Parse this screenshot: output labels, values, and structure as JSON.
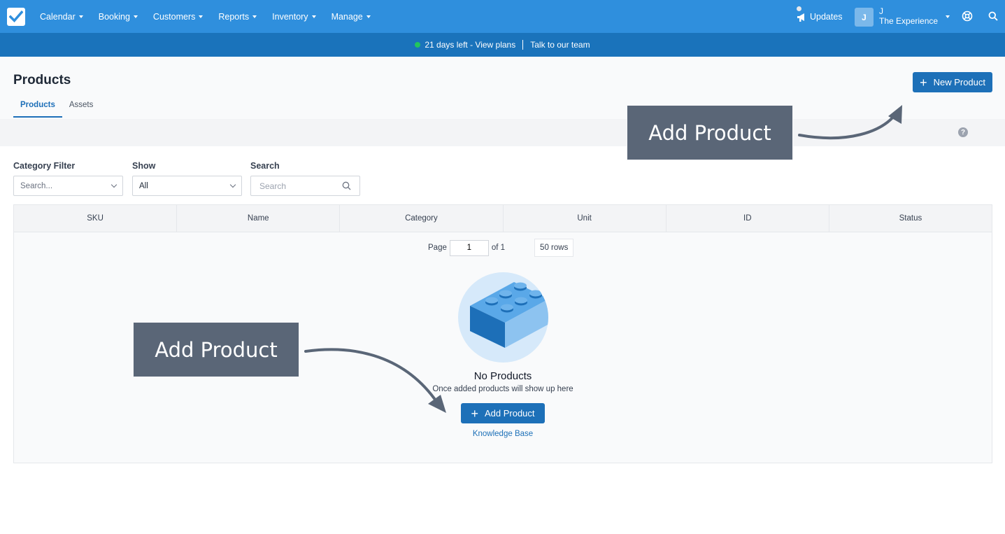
{
  "nav": {
    "menu": [
      {
        "label": "Calendar"
      },
      {
        "label": "Booking"
      },
      {
        "label": "Customers"
      },
      {
        "label": "Reports"
      },
      {
        "label": "Inventory"
      },
      {
        "label": "Manage"
      }
    ],
    "updates_label": "Updates",
    "avatar_initial": "J",
    "user_name": "J",
    "user_org": "The Experience"
  },
  "promo": {
    "trial_text": "21 days left - View plans",
    "team_text": "Talk to our team"
  },
  "page": {
    "title": "Products",
    "tabs": [
      {
        "label": "Products",
        "active": true
      },
      {
        "label": "Assets",
        "active": false
      }
    ],
    "new_button_label": "New Product",
    "help_glyph": "?"
  },
  "filters": {
    "category_label": "Category Filter",
    "category_placeholder": "Search...",
    "show_label": "Show",
    "show_value": "All",
    "search_label": "Search",
    "search_placeholder": "Search"
  },
  "table": {
    "columns": [
      "SKU",
      "Name",
      "Category",
      "Unit",
      "ID",
      "Status"
    ],
    "pager": {
      "page_label": "Page",
      "page_value": "1",
      "of_label": "of 1",
      "rows_label": "50 rows"
    }
  },
  "empty": {
    "title": "No Products",
    "subtitle": "Once added products will show up here",
    "add_button_label": "Add Product",
    "kb_link": "Knowledge Base"
  },
  "callouts": {
    "top": "Add Product",
    "bottom": "Add Product"
  },
  "colors": {
    "nav": "#2f8fdd",
    "promo": "#1a73bb",
    "primary_button": "#1d70b8",
    "callout": "#5a6677"
  }
}
